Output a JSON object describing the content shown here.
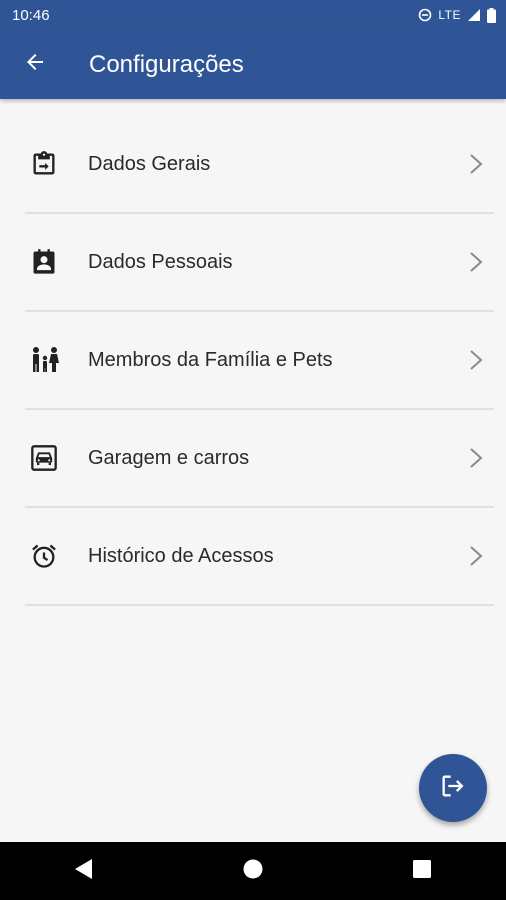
{
  "status_bar": {
    "time": "10:46",
    "network": "LTE",
    "icons": [
      "do-not-disturb-icon",
      "signal-icon",
      "battery-icon"
    ]
  },
  "app_bar": {
    "title": "Configurações",
    "back_icon": "arrow-back-icon"
  },
  "menu": [
    {
      "label": "Dados Gerais",
      "icon": "clipboard-arrow-icon"
    },
    {
      "label": "Dados Pessoais",
      "icon": "contact-card-icon"
    },
    {
      "label": "Membros da Família e Pets",
      "icon": "family-icon"
    },
    {
      "label": "Garagem e carros",
      "icon": "garage-car-icon"
    },
    {
      "label": "Histórico de Acessos",
      "icon": "alarm-clock-icon"
    }
  ],
  "fab": {
    "icon": "logout-icon"
  },
  "nav_bar": {
    "icons": [
      "back-triangle-icon",
      "home-circle-icon",
      "recents-square-icon"
    ]
  },
  "colors": {
    "primary": "#2f5597",
    "background": "#f6f6f6",
    "divider": "#e1e1e1"
  }
}
